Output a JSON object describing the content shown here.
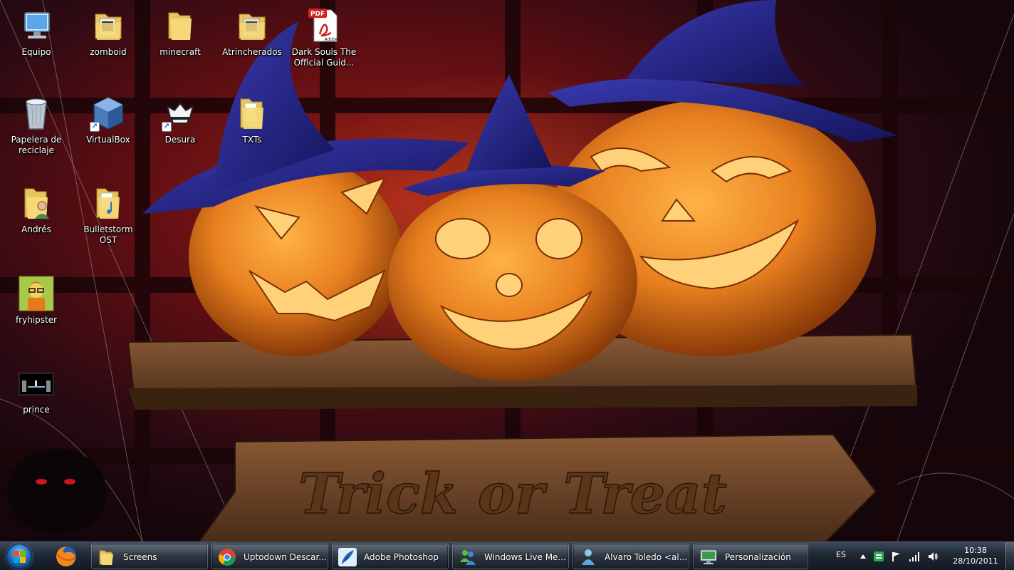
{
  "desktop": {
    "icons": [
      {
        "label": "Equipo"
      },
      {
        "label": "zomboid"
      },
      {
        "label": "minecraft"
      },
      {
        "label": "Atrincherados"
      },
      {
        "label": "Dark Souls The Official Guid..."
      },
      {
        "label": "Papelera de reciclaje"
      },
      {
        "label": "VirtualBox"
      },
      {
        "label": "Desura"
      },
      {
        "label": "TXTs"
      },
      {
        "label": "Andrés"
      },
      {
        "label": "Bulletstorm OST"
      },
      {
        "label": "fryhipster"
      },
      {
        "label": "prince"
      }
    ],
    "wallpaper": {
      "sign_text": "Trick or Treat",
      "pdf_badge": "PDF",
      "pdf_vendor": "Adobe"
    }
  },
  "taskbar": {
    "buttons": [
      {
        "label": "Screens",
        "icon": "folder-icon"
      },
      {
        "label": "Uptodown Descar...",
        "icon": "chrome-icon"
      },
      {
        "label": "Adobe Photoshop",
        "icon": "photoshop-feather-icon"
      },
      {
        "label": "Windows Live Me...",
        "icon": "messenger-icon"
      },
      {
        "label": "Alvaro Toledo <al...",
        "icon": "messenger-contact-icon"
      },
      {
        "label": "Personalización",
        "icon": "monitor-icon"
      }
    ],
    "pinned": [
      "firefox-icon"
    ],
    "tray": {
      "language": "ES",
      "time": "10:38",
      "date": "28/10/2011"
    }
  },
  "colors": {
    "taskbar_top": "#3b4a5c",
    "taskbar_bottom": "#121922",
    "wallpaper_red": "#9a1b18",
    "pumpkin_orange": "#e8801f",
    "hat_blue": "#2a2a8f"
  }
}
